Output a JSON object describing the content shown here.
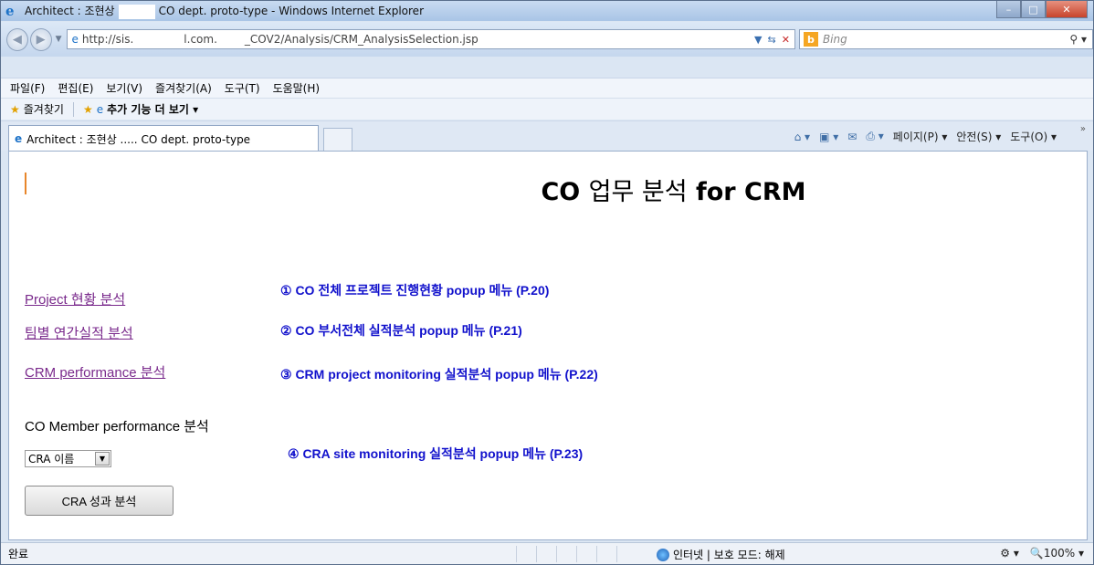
{
  "window": {
    "title_left": "Architect : 조현상",
    "title_right": "CO dept. proto-type - Windows Internet Explorer"
  },
  "address": {
    "url_part1": "http://sis.",
    "url_part2": "l.com.",
    "url_part3": "_COV2/Analysis/CRM_AnalysisSelection.jsp",
    "search_placeholder": "Bing"
  },
  "menu": [
    "파일(F)",
    "편집(E)",
    "보기(V)",
    "즐겨찾기(A)",
    "도구(T)",
    "도움말(H)"
  ],
  "favorites": {
    "label": "즐겨찾기",
    "addons": "추가 기능 더 보기 ▾"
  },
  "tab": {
    "label": "Architect : 조현상 ..... CO dept. proto-type"
  },
  "commandbar": {
    "page": "페이지(P) ▾",
    "safety": "안전(S) ▾",
    "tools": "도구(O) ▾"
  },
  "content": {
    "heading_co": "CO",
    "heading_mid": "업무 분석",
    "heading_tail": "for CRM",
    "links": [
      "Project 현황 분석",
      "팀별 연간실적 분석",
      "CRM performance 분석"
    ],
    "annotations": [
      "① CO 전체 프로젝트 진행현황 popup 메뉴 (P.20)",
      "② CO 부서전체 실적분석 popup 메뉴 (P.21)",
      "③ CRM project monitoring 실적분석 popup 메뉴 (P.22)",
      "④ CRA site monitoring 실적분석 popup 메뉴 (P.23)"
    ],
    "member_label": "CO Member performance 분석",
    "select_value": "CRA 이름",
    "button_label": "CRA 성과 분석"
  },
  "status": {
    "done": "완료",
    "zone": "인터넷 | 보호 모드: 해제",
    "zoom": "100%"
  }
}
